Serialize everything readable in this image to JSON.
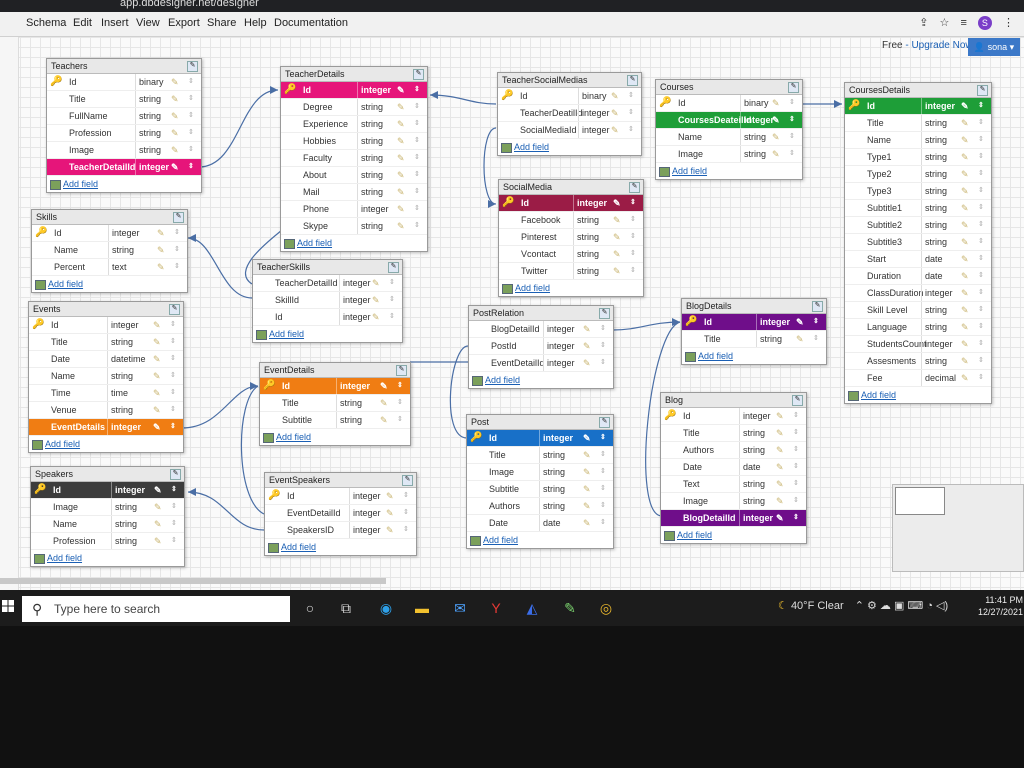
{
  "browser": {
    "url": "app.dbdesigner.net/designer",
    "avatar_letter": "S"
  },
  "menu": [
    "Schema",
    "Edit",
    "Insert",
    "View",
    "Export",
    "Share",
    "Help",
    "Documentation"
  ],
  "account": {
    "free_label": "Free",
    "upgrade_label": "Upgrade Now",
    "user_name": "sona"
  },
  "add_field_label": "Add field",
  "colors": {
    "pink": "#e6157a",
    "green": "#1e9e38",
    "orange": "#f07d13",
    "maroon": "#9b1c46",
    "purple": "#6f0e8a",
    "blue": "#1870c8",
    "dark": "#3c3c3c"
  },
  "tables": {
    "teachers": {
      "title": "Teachers",
      "fields": [
        [
          "Id",
          "binary"
        ],
        [
          "Title",
          "string"
        ],
        [
          "FullName",
          "string"
        ],
        [
          "Profession",
          "string"
        ],
        [
          "Image",
          "string"
        ],
        [
          "TeacherDetailId",
          "integer"
        ]
      ]
    },
    "teacherdetails": {
      "title": "TeacherDetails",
      "fields": [
        [
          "Id",
          "integer"
        ],
        [
          "Degree",
          "string"
        ],
        [
          "Experience",
          "string"
        ],
        [
          "Hobbies",
          "string"
        ],
        [
          "Faculty",
          "string"
        ],
        [
          "About",
          "string"
        ],
        [
          "Mail",
          "string"
        ],
        [
          "Phone",
          "integer"
        ],
        [
          "Skype",
          "string"
        ]
      ]
    },
    "teachersocialmedias": {
      "title": "TeacherSocialMedias",
      "fields": [
        [
          "Id",
          "binary"
        ],
        [
          "TeacherDeatilId",
          "integer"
        ],
        [
          "SocialMediaId",
          "integer"
        ]
      ]
    },
    "courses": {
      "title": "Courses",
      "fields": [
        [
          "Id",
          "binary"
        ],
        [
          "CoursesDeateilId",
          "integer"
        ],
        [
          "Name",
          "string"
        ],
        [
          "Image",
          "string"
        ]
      ]
    },
    "coursesdetails": {
      "title": "CoursesDetails",
      "fields": [
        [
          "Id",
          "integer"
        ],
        [
          "Title",
          "string"
        ],
        [
          "Name",
          "string"
        ],
        [
          "Type1",
          "string"
        ],
        [
          "Type2",
          "string"
        ],
        [
          "Type3",
          "string"
        ],
        [
          "Subtitle1",
          "string"
        ],
        [
          "Subtitle2",
          "string"
        ],
        [
          "Subtitle3",
          "string"
        ],
        [
          "Start",
          "date"
        ],
        [
          "Duration",
          "date"
        ],
        [
          "ClassDuration",
          "integer"
        ],
        [
          "Skill Level",
          "string"
        ],
        [
          "Language",
          "string"
        ],
        [
          "StudentsCount",
          "integer"
        ],
        [
          "Assesments",
          "string"
        ],
        [
          "Fee",
          "decimal"
        ]
      ]
    },
    "skills": {
      "title": "Skills",
      "fields": [
        [
          "Id",
          "integer"
        ],
        [
          "Name",
          "string"
        ],
        [
          "Percent",
          "text"
        ]
      ]
    },
    "teacherskills": {
      "title": "TeacherSkills",
      "fields": [
        [
          "TeacherDetailId",
          "integer"
        ],
        [
          "SkillId",
          "integer"
        ],
        [
          "Id",
          "integer"
        ]
      ]
    },
    "socialmedia": {
      "title": "SocialMedia",
      "fields": [
        [
          "Id",
          "integer"
        ],
        [
          "Facebook",
          "string"
        ],
        [
          "Pinterest",
          "string"
        ],
        [
          "Vcontact",
          "string"
        ],
        [
          "Twitter",
          "string"
        ]
      ]
    },
    "events": {
      "title": "Events",
      "fields": [
        [
          "Id",
          "integer"
        ],
        [
          "Title",
          "string"
        ],
        [
          "Date",
          "datetime"
        ],
        [
          "Name",
          "string"
        ],
        [
          "Time",
          "time"
        ],
        [
          "Venue",
          "string"
        ],
        [
          "EventDetails",
          "integer"
        ]
      ]
    },
    "eventdetails": {
      "title": "EventDetails",
      "fields": [
        [
          "Id",
          "integer"
        ],
        [
          "Title",
          "string"
        ],
        [
          "Subtitle",
          "string"
        ]
      ]
    },
    "postrelation": {
      "title": "PostRelation",
      "fields": [
        [
          "BlogDetailId",
          "integer"
        ],
        [
          "PostId",
          "integer"
        ],
        [
          "EventDetailId",
          "integer"
        ]
      ]
    },
    "blogdetails": {
      "title": "BlogDetails",
      "fields": [
        [
          "Id",
          "integer"
        ],
        [
          "Title",
          "string"
        ]
      ]
    },
    "blog": {
      "title": "Blog",
      "fields": [
        [
          "Id",
          "integer"
        ],
        [
          "Title",
          "string"
        ],
        [
          "Authors",
          "string"
        ],
        [
          "Date",
          "date"
        ],
        [
          "Text",
          "string"
        ],
        [
          "Image",
          "string"
        ],
        [
          "BlogDetailId",
          "integer"
        ]
      ]
    },
    "post": {
      "title": "Post",
      "fields": [
        [
          "Id",
          "integer"
        ],
        [
          "Title",
          "string"
        ],
        [
          "Image",
          "string"
        ],
        [
          "Subtitle",
          "string"
        ],
        [
          "Authors",
          "string"
        ],
        [
          "Date",
          "date"
        ]
      ]
    },
    "speakers": {
      "title": "Speakers",
      "fields": [
        [
          "Id",
          "integer"
        ],
        [
          "Image",
          "string"
        ],
        [
          "Name",
          "string"
        ],
        [
          "Profession",
          "string"
        ]
      ]
    },
    "eventspeakers": {
      "title": "EventSpeakers",
      "fields": [
        [
          "Id",
          "integer"
        ],
        [
          "EventDetailId",
          "integer"
        ],
        [
          "SpeakersID",
          "integer"
        ]
      ]
    }
  },
  "taskbar": {
    "search_placeholder": "Type here to search",
    "weather": "40°F Clear",
    "time": "11:41 PM",
    "date": "12/27/2021"
  }
}
